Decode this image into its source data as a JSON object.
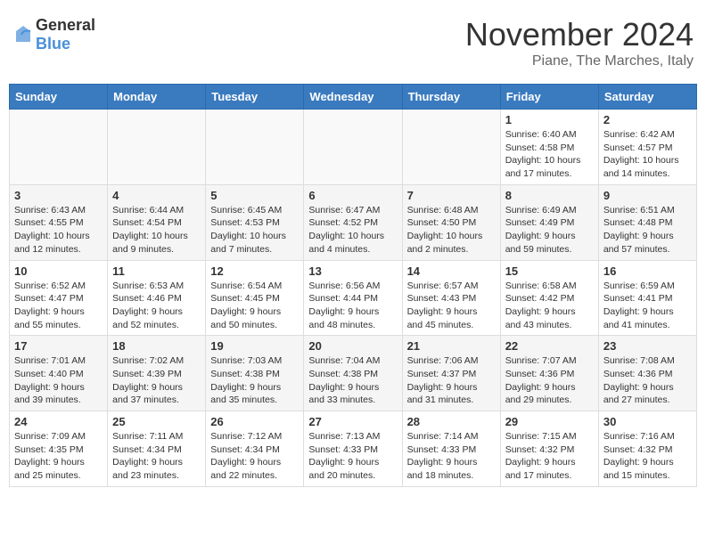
{
  "header": {
    "logo_general": "General",
    "logo_blue": "Blue",
    "month_title": "November 2024",
    "location": "Piane, The Marches, Italy"
  },
  "weekdays": [
    "Sunday",
    "Monday",
    "Tuesday",
    "Wednesday",
    "Thursday",
    "Friday",
    "Saturday"
  ],
  "weeks": [
    [
      {
        "day": "",
        "info": ""
      },
      {
        "day": "",
        "info": ""
      },
      {
        "day": "",
        "info": ""
      },
      {
        "day": "",
        "info": ""
      },
      {
        "day": "",
        "info": ""
      },
      {
        "day": "1",
        "info": "Sunrise: 6:40 AM\nSunset: 4:58 PM\nDaylight: 10 hours and 17 minutes."
      },
      {
        "day": "2",
        "info": "Sunrise: 6:42 AM\nSunset: 4:57 PM\nDaylight: 10 hours and 14 minutes."
      }
    ],
    [
      {
        "day": "3",
        "info": "Sunrise: 6:43 AM\nSunset: 4:55 PM\nDaylight: 10 hours and 12 minutes."
      },
      {
        "day": "4",
        "info": "Sunrise: 6:44 AM\nSunset: 4:54 PM\nDaylight: 10 hours and 9 minutes."
      },
      {
        "day": "5",
        "info": "Sunrise: 6:45 AM\nSunset: 4:53 PM\nDaylight: 10 hours and 7 minutes."
      },
      {
        "day": "6",
        "info": "Sunrise: 6:47 AM\nSunset: 4:52 PM\nDaylight: 10 hours and 4 minutes."
      },
      {
        "day": "7",
        "info": "Sunrise: 6:48 AM\nSunset: 4:50 PM\nDaylight: 10 hours and 2 minutes."
      },
      {
        "day": "8",
        "info": "Sunrise: 6:49 AM\nSunset: 4:49 PM\nDaylight: 9 hours and 59 minutes."
      },
      {
        "day": "9",
        "info": "Sunrise: 6:51 AM\nSunset: 4:48 PM\nDaylight: 9 hours and 57 minutes."
      }
    ],
    [
      {
        "day": "10",
        "info": "Sunrise: 6:52 AM\nSunset: 4:47 PM\nDaylight: 9 hours and 55 minutes."
      },
      {
        "day": "11",
        "info": "Sunrise: 6:53 AM\nSunset: 4:46 PM\nDaylight: 9 hours and 52 minutes."
      },
      {
        "day": "12",
        "info": "Sunrise: 6:54 AM\nSunset: 4:45 PM\nDaylight: 9 hours and 50 minutes."
      },
      {
        "day": "13",
        "info": "Sunrise: 6:56 AM\nSunset: 4:44 PM\nDaylight: 9 hours and 48 minutes."
      },
      {
        "day": "14",
        "info": "Sunrise: 6:57 AM\nSunset: 4:43 PM\nDaylight: 9 hours and 45 minutes."
      },
      {
        "day": "15",
        "info": "Sunrise: 6:58 AM\nSunset: 4:42 PM\nDaylight: 9 hours and 43 minutes."
      },
      {
        "day": "16",
        "info": "Sunrise: 6:59 AM\nSunset: 4:41 PM\nDaylight: 9 hours and 41 minutes."
      }
    ],
    [
      {
        "day": "17",
        "info": "Sunrise: 7:01 AM\nSunset: 4:40 PM\nDaylight: 9 hours and 39 minutes."
      },
      {
        "day": "18",
        "info": "Sunrise: 7:02 AM\nSunset: 4:39 PM\nDaylight: 9 hours and 37 minutes."
      },
      {
        "day": "19",
        "info": "Sunrise: 7:03 AM\nSunset: 4:38 PM\nDaylight: 9 hours and 35 minutes."
      },
      {
        "day": "20",
        "info": "Sunrise: 7:04 AM\nSunset: 4:38 PM\nDaylight: 9 hours and 33 minutes."
      },
      {
        "day": "21",
        "info": "Sunrise: 7:06 AM\nSunset: 4:37 PM\nDaylight: 9 hours and 31 minutes."
      },
      {
        "day": "22",
        "info": "Sunrise: 7:07 AM\nSunset: 4:36 PM\nDaylight: 9 hours and 29 minutes."
      },
      {
        "day": "23",
        "info": "Sunrise: 7:08 AM\nSunset: 4:36 PM\nDaylight: 9 hours and 27 minutes."
      }
    ],
    [
      {
        "day": "24",
        "info": "Sunrise: 7:09 AM\nSunset: 4:35 PM\nDaylight: 9 hours and 25 minutes."
      },
      {
        "day": "25",
        "info": "Sunrise: 7:11 AM\nSunset: 4:34 PM\nDaylight: 9 hours and 23 minutes."
      },
      {
        "day": "26",
        "info": "Sunrise: 7:12 AM\nSunset: 4:34 PM\nDaylight: 9 hours and 22 minutes."
      },
      {
        "day": "27",
        "info": "Sunrise: 7:13 AM\nSunset: 4:33 PM\nDaylight: 9 hours and 20 minutes."
      },
      {
        "day": "28",
        "info": "Sunrise: 7:14 AM\nSunset: 4:33 PM\nDaylight: 9 hours and 18 minutes."
      },
      {
        "day": "29",
        "info": "Sunrise: 7:15 AM\nSunset: 4:32 PM\nDaylight: 9 hours and 17 minutes."
      },
      {
        "day": "30",
        "info": "Sunrise: 7:16 AM\nSunset: 4:32 PM\nDaylight: 9 hours and 15 minutes."
      }
    ]
  ]
}
